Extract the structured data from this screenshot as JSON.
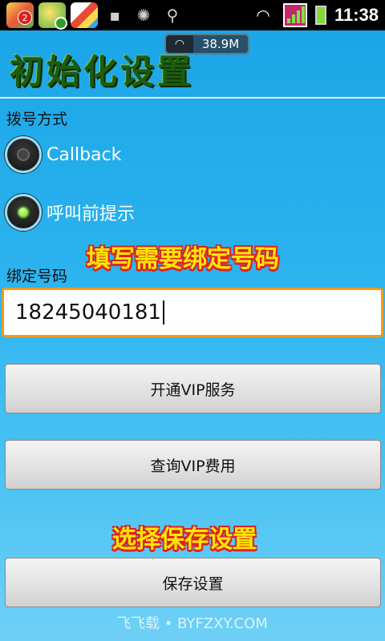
{
  "status_bar": {
    "badge_count": "2",
    "time": "11:38",
    "icons": [
      "app-icon-1",
      "app-icon-2",
      "app-icon-3",
      "message-icon",
      "android-debug-icon",
      "usb-icon",
      "wifi-icon",
      "signal-icon",
      "battery-charging-icon"
    ]
  },
  "header": {
    "title": "初始化设置",
    "speed_value": "38.9M"
  },
  "dial_mode": {
    "label": "拨号方式",
    "options": [
      {
        "label": "Callback",
        "selected": false
      },
      {
        "label": "呼叫前提示",
        "selected": true
      }
    ]
  },
  "annotations": {
    "fill_number": "填写需要绑定号码",
    "choose_save": "选择保存设置"
  },
  "bind_number": {
    "label": "绑定号码",
    "value": "18245040181"
  },
  "buttons": {
    "open_vip": "开通VIP服务",
    "query_vip": "查询VIP费用",
    "save": "保存设置"
  },
  "watermark": "飞飞载 • BYFZXY.COM",
  "colors": {
    "background": "#2ab2ee",
    "accent_input_border": "#f09a1a",
    "callout_text": "#ffe600",
    "callout_outline": "#dd2222",
    "title_text": "#1c5d10"
  }
}
